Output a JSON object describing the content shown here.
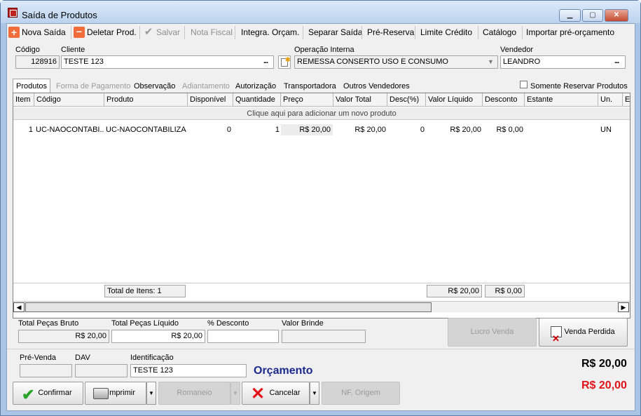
{
  "window": {
    "title": "Saída de Produtos",
    "controls": [
      "minimize-icon",
      "maximize-icon",
      "close-icon"
    ]
  },
  "toolbar": {
    "new_label": "Nova Saída",
    "delete_label": "Deletar Prod.",
    "save_label": "Salvar",
    "invoice_label": "Nota Fiscal",
    "integrate_label": "Integra. Orçam.",
    "split_label": "Separar Saída",
    "prereserve_label": "Pré-Reserva",
    "credit_label": "Limite Crédito",
    "catalog_label": "Catálogo",
    "import_label": "Importar pré-orçamento"
  },
  "header": {
    "code_label": "Código",
    "code_value": "128916",
    "client_label": "Cliente",
    "client_value": "TESTE 123",
    "operation_label": "Operação Interna",
    "operation_value": "REMESSA CONSERTO USO E CONSUMO",
    "seller_label": "Vendedor",
    "seller_value": "LEANDRO",
    "dots": "..."
  },
  "tabs": {
    "products": "Produtos",
    "payment": "Forma de Pagamento",
    "notes": "Observação",
    "advance": "Adiantamento",
    "authorization": "Autorização",
    "carrier": "Transportadora",
    "other_sellers": "Outros Vendedores",
    "reserve_only": "Somente Reservar Produtos"
  },
  "grid": {
    "columns": [
      "Item",
      "Código",
      "Produto",
      "Disponível",
      "Quantidade",
      "Preço",
      "Valor Total",
      "Desc(%)",
      "Valor Líquido",
      "Desconto",
      "Estante",
      "Un.",
      "En"
    ],
    "add_row_text": "Clique aqui para adicionar um novo produto",
    "rows": [
      [
        "1",
        "UC-NAOCONTABI...",
        "UC-NAOCONTABILIZA",
        "0",
        "1",
        "R$ 20,00",
        "R$ 20,00",
        "0",
        "R$ 20,00",
        "R$ 0,00",
        "",
        "UN",
        ""
      ]
    ],
    "footer_items": "Total de Itens: 1",
    "footer_total": "R$ 20,00",
    "footer_discount": "R$ 0,00"
  },
  "summary": {
    "gross_label": "Total Peças Bruto",
    "gross_value": "R$ 20,00",
    "net_label": "Total Peças Líquido",
    "net_value": "R$ 20,00",
    "discount_label": "% Desconto",
    "discount_value": "",
    "gift_label": "Valor Brinde",
    "gift_value": "",
    "profit_button": "Lucro Venda",
    "lost_sale_button": "Venda Perdida"
  },
  "bottom": {
    "presale_label": "Pré-Venda",
    "dav_label": "DAV",
    "ident_label": "Identificação",
    "ident_value": "TESTE 123",
    "status_text": "Orçamento",
    "total_black": "R$ 20,00",
    "total_red": "R$ 20,00",
    "confirm_button": "Confirmar",
    "print_button": "Imprimir",
    "romaneio_button": "Romaneio",
    "cancel_button": "Cancelar",
    "nf_origin_button": "NF. Origem"
  },
  "colors": {
    "status_blue": "#1c2a8f",
    "total_red": "#e0141a",
    "title_bar": "#bcd3ee"
  }
}
